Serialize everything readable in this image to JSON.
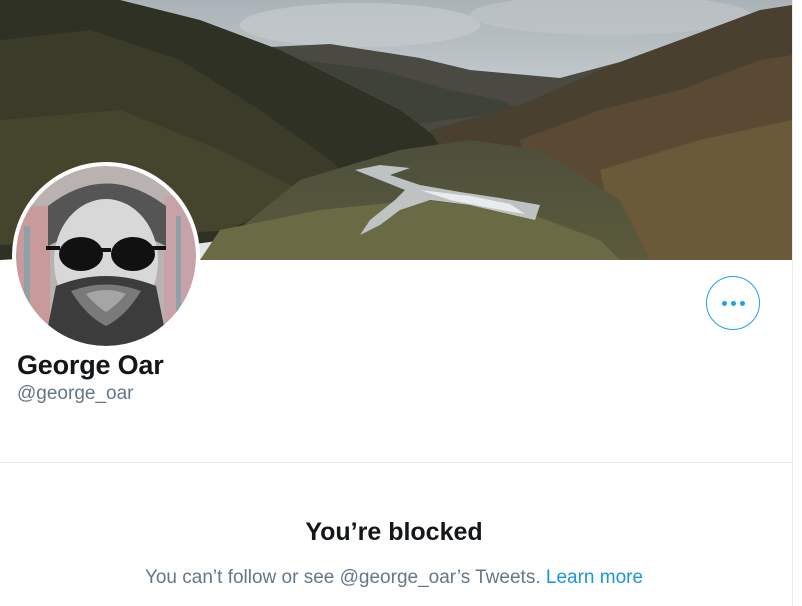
{
  "profile": {
    "display_name": "George Oar",
    "handle": "@george_oar"
  },
  "actions": {
    "more_icon": "more-horizontal-icon"
  },
  "blocked_notice": {
    "title": "You’re blocked",
    "message": "You can’t follow or see @george_oar’s Tweets.",
    "link_label": "Learn more"
  },
  "colors": {
    "accent": "#1da1f2",
    "link": "#1b95e0",
    "primary_text": "#14171a",
    "secondary_text": "#657786",
    "border": "#e6ecf0"
  }
}
